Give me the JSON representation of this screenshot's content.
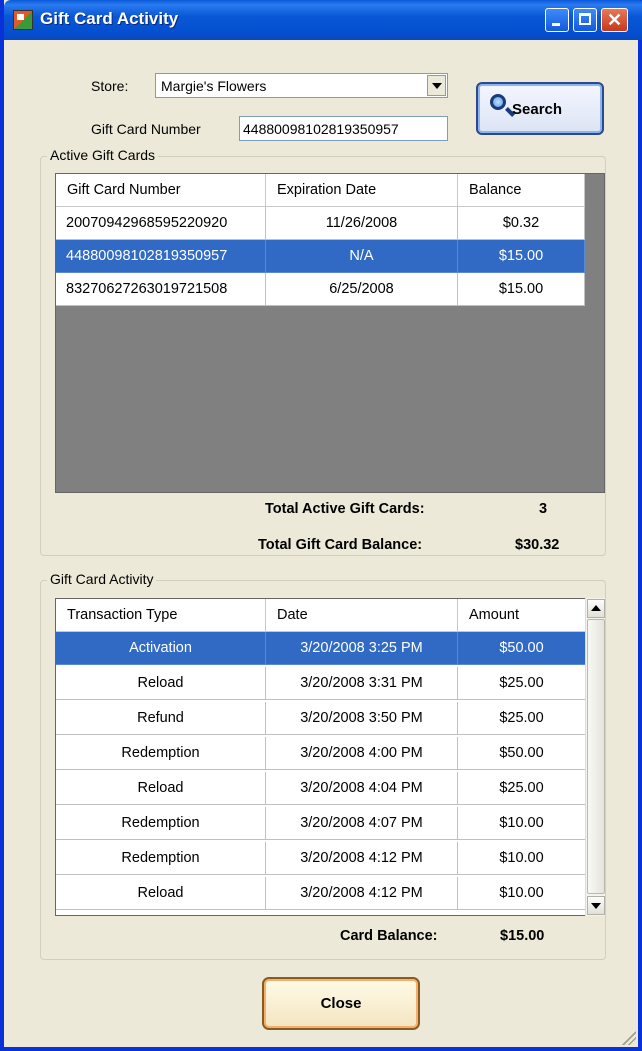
{
  "window": {
    "title": "Gift Card Activity"
  },
  "form": {
    "store_label": "Store:",
    "store_value": "Margie's Flowers",
    "gift_card_number_label": "Gift Card Number",
    "gift_card_number_value": "44880098102819350957",
    "search_button": "Search"
  },
  "active_cards": {
    "group_label": "Active Gift Cards",
    "columns": [
      "Gift Card Number",
      "Expiration Date",
      "Balance"
    ],
    "rows": [
      {
        "number": "20070942968595220920",
        "expiration": "11/26/2008",
        "balance": "$0.32"
      },
      {
        "number": "44880098102819350957",
        "expiration": "N/A",
        "balance": "$15.00"
      },
      {
        "number": "83270627263019721508",
        "expiration": "6/25/2008",
        "balance": "$15.00"
      }
    ],
    "selected_row_index": 1,
    "total_cards_label": "Total Active Gift Cards:",
    "total_cards_value": "3",
    "total_balance_label": "Total Gift Card Balance:",
    "total_balance_value": "$30.32"
  },
  "activity": {
    "group_label": "Gift Card Activity",
    "columns": [
      "Transaction Type",
      "Date",
      "Amount"
    ],
    "rows": [
      {
        "type": "Activation",
        "date": "3/20/2008 3:25 PM",
        "amount": "$50.00"
      },
      {
        "type": "Reload",
        "date": "3/20/2008 3:31 PM",
        "amount": "$25.00"
      },
      {
        "type": "Refund",
        "date": "3/20/2008 3:50 PM",
        "amount": "$25.00"
      },
      {
        "type": "Redemption",
        "date": "3/20/2008 4:00 PM",
        "amount": "$50.00"
      },
      {
        "type": "Reload",
        "date": "3/20/2008 4:04 PM",
        "amount": "$25.00"
      },
      {
        "type": "Redemption",
        "date": "3/20/2008 4:07 PM",
        "amount": "$10.00"
      },
      {
        "type": "Redemption",
        "date": "3/20/2008 4:12 PM",
        "amount": "$10.00"
      },
      {
        "type": "Reload",
        "date": "3/20/2008 4:12 PM",
        "amount": "$10.00"
      }
    ],
    "selected_row_index": 0,
    "card_balance_label": "Card Balance:",
    "card_balance_value": "$15.00"
  },
  "close_button": "Close",
  "colors": {
    "selection": "#316ac5",
    "titlebar": "#0a58d6",
    "grid_bg": "#808080",
    "window_bg": "#ece9d8"
  }
}
